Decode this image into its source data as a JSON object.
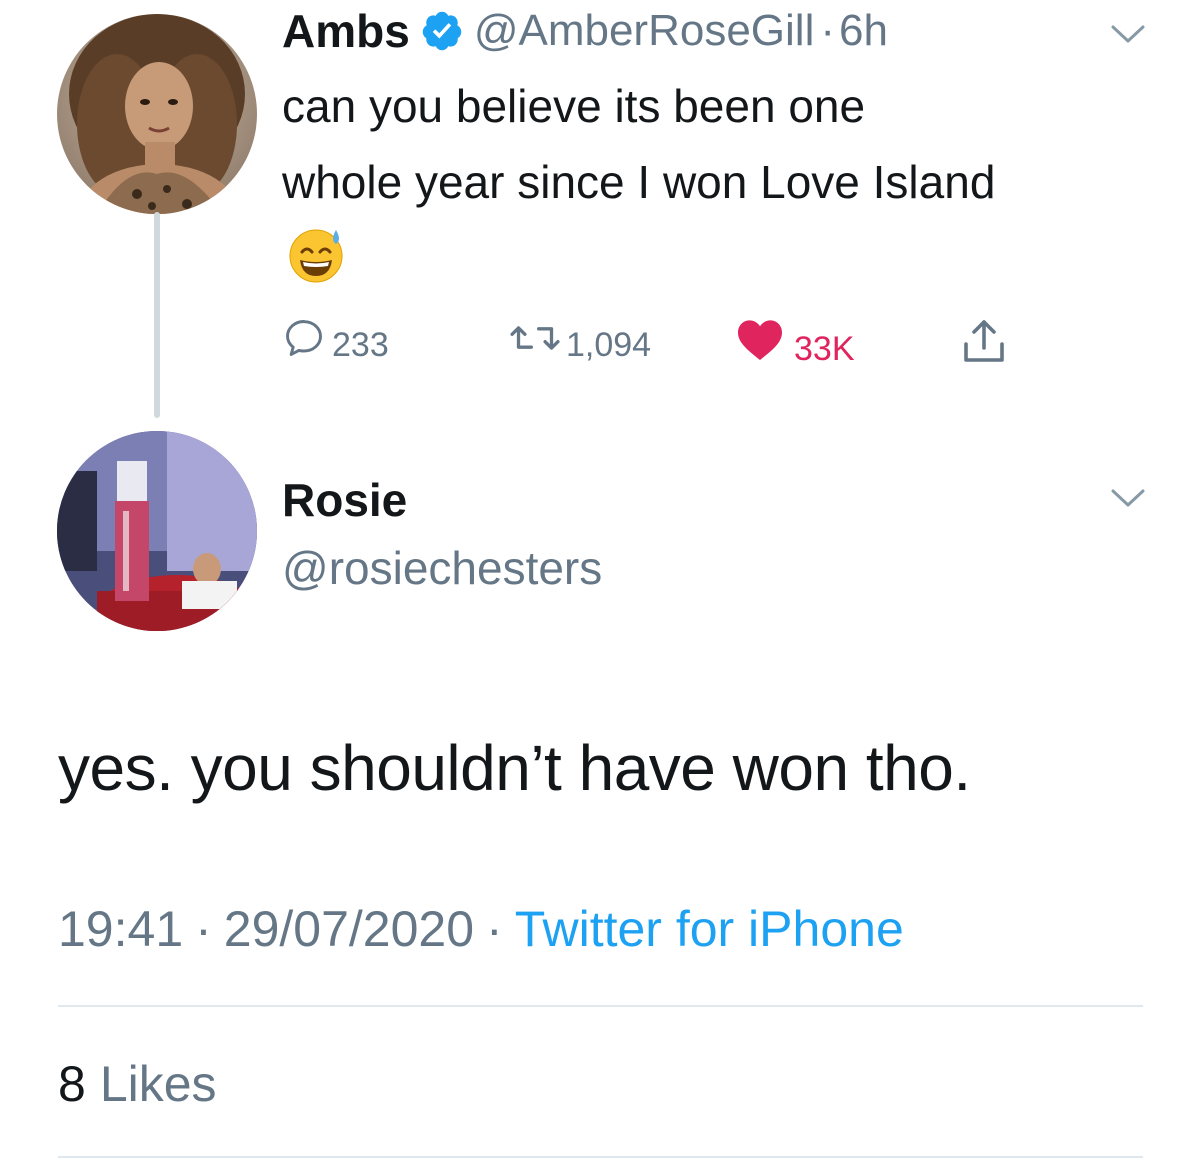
{
  "parent_tweet": {
    "author_name": "Ambs",
    "author_handle": "@AmberRoseGill",
    "separator": "·",
    "time_ago": "6h",
    "text_line1": "can you believe its been one",
    "text_line2": "whole year since I won Love Island",
    "emoji": "😅",
    "verified": true,
    "actions": {
      "replies": "233",
      "retweets": "1,094",
      "likes": "33K"
    }
  },
  "reply_tweet": {
    "author_name": "Rosie",
    "author_handle": "@rosiechesters",
    "text": "yes. you shouldn’t have won tho.",
    "time": "19:41",
    "date": "29/07/2020",
    "separator": "·",
    "source": "Twitter for iPhone",
    "likes_count": "8",
    "likes_label": "Likes"
  },
  "colors": {
    "text_primary": "#14171a",
    "text_secondary": "#657786",
    "accent_blue": "#1da1f2",
    "like_red": "#e0245e",
    "divider": "#e1e8ed"
  }
}
